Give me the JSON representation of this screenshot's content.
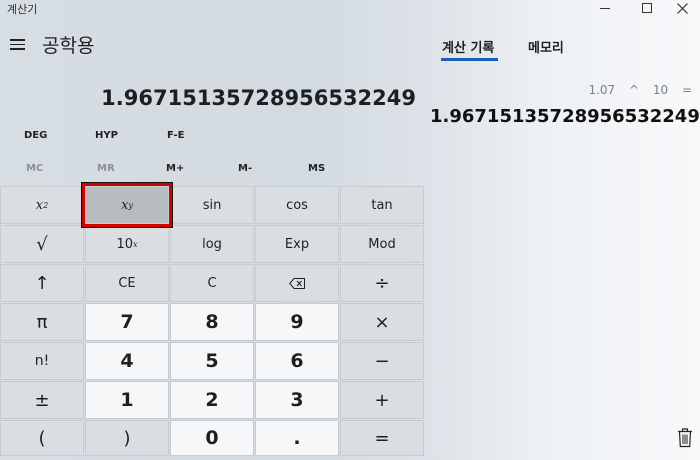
{
  "window": {
    "title": "계산기"
  },
  "header": {
    "mode": "공학용"
  },
  "display": {
    "value": "1.9671513572895653224​9"
  },
  "mode_buttons": [
    "DEG",
    "HYP",
    "F-E"
  ],
  "memory_buttons": [
    "MC",
    "MR",
    "M+",
    "M-",
    "MS"
  ],
  "keys": {
    "r1": [
      "x",
      "sin",
      "cos",
      "tan"
    ],
    "r2": [
      "√",
      "10",
      "log",
      "Exp",
      "Mod"
    ],
    "r3": [
      "↑",
      "CE",
      "C",
      "÷"
    ],
    "r4": [
      "π",
      "7",
      "8",
      "9",
      "×"
    ],
    "r5": [
      "n!",
      "4",
      "5",
      "6",
      "−"
    ],
    "r6": [
      "±",
      "1",
      "2",
      "3",
      "+"
    ],
    "r7": [
      "(",
      ")",
      "0",
      ".",
      "="
    ]
  },
  "tabs": [
    "계산 기록",
    "메모리"
  ],
  "history": {
    "expression": "1.07 ^ 10 =",
    "result": "1.96715135728956532249"
  }
}
